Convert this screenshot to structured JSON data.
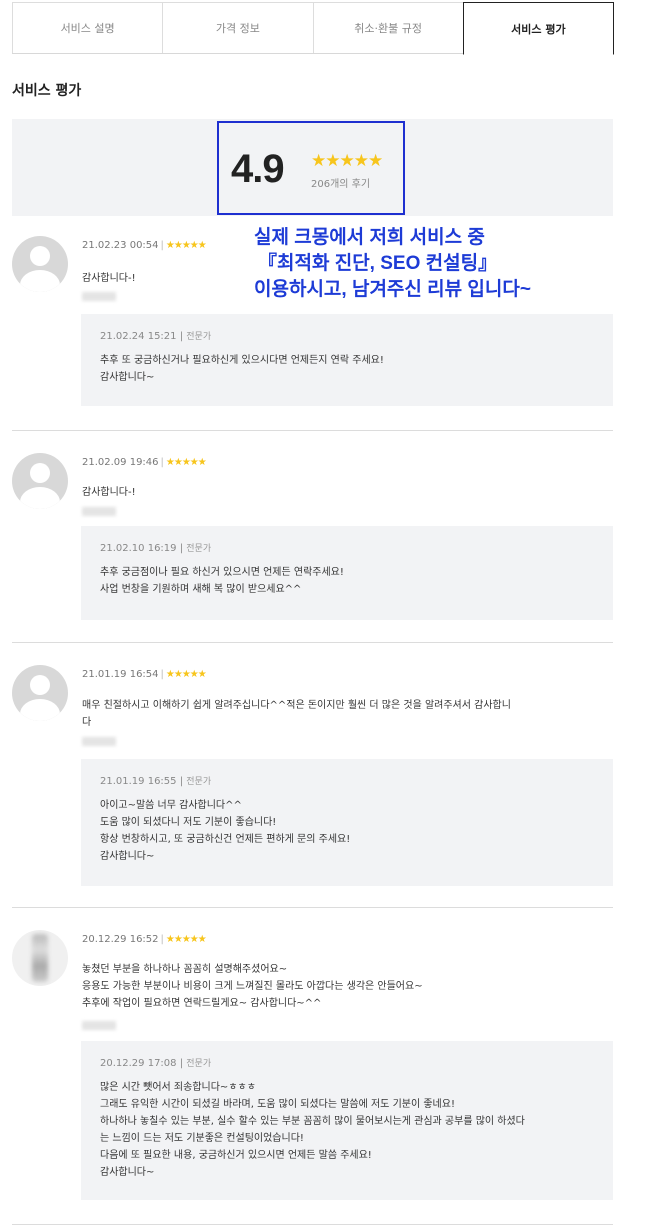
{
  "tabs": [
    {
      "label": "서비스 설명"
    },
    {
      "label": "가격 정보"
    },
    {
      "label": "취소·환불 규정"
    },
    {
      "label": "서비스 평가"
    }
  ],
  "section_title": "서비스 평가",
  "summary": {
    "score": "4.9",
    "stars": "★★★★★",
    "review_count": "206개의 후기",
    "highlight_color": "#1e2fd0"
  },
  "overlay": {
    "line1": "실제 크몽에서 저희 서비스 중",
    "line2": "『최적화 진단, SEO 컨설팅』",
    "line3": "이용하시고, 남겨주신 리뷰 입니다~",
    "color": "#1d3bd6"
  },
  "reviews": [
    {
      "date": "21.02.23 00:54",
      "stars": "★★★★★",
      "text": "감사합니다-!",
      "reply": {
        "date": "21.02.24 15:21",
        "role": "전문가",
        "text": "추후 또 궁금하신거나 필요하신게 있으시다면 언제든지 연락 주세요!\n감사합니다~"
      }
    },
    {
      "date": "21.02.09 19:46",
      "stars": "★★★★★",
      "text": "감사합니다-!",
      "reply": {
        "date": "21.02.10 16:19",
        "role": "전문가",
        "text": "추후 궁금점이나 필요 하신거 있으시면 언제든 연락주세요!\n사업 번창을 기원하며 새해 복 많이 받으세요^^"
      }
    },
    {
      "date": "21.01.19 16:54",
      "stars": "★★★★★",
      "text": "매우 친절하시고 이해하기 쉽게 알려주십니다^^적은 돈이지만 훨씬 더 많은 것을 알려주셔서 감사합니\n다",
      "reply": {
        "date": "21.01.19 16:55",
        "role": "전문가",
        "text": "아이고~말씀 너무 감사합니다^^\n도움 많이 되셨다니 저도 기분이 좋습니다!\n항상 번창하시고, 또 궁금하신건 언제든 편하게 문의 주세요!\n감사합니다~"
      }
    },
    {
      "date": "20.12.29 16:52",
      "stars": "★★★★★",
      "text": "놓쳤던 부분을 하나하나 꼼꼼히 설명해주셨어요~\n응용도 가능한 부분이나 비용이 크게 느껴질진 몰라도 아깝다는 생각은 안들어요~\n추후에 작업이 필요하면 연락드릴게요~ 감사합니다~^^",
      "reply": {
        "date": "20.12.29 17:08",
        "role": "전문가",
        "text": "많은 시간 뺏어서 죄송합니다~ㅎㅎㅎ\n그래도 유익한 시간이 되셨길 바라며, 도움 많이 되셨다는 말씀에 저도 기분이 좋네요!\n하나하나 놓칠수 있는 부분, 실수 할수 있는 부분 꼼꼼히 많이 물어보시는게 관심과 공부를 많이 하셨다\n는 느낌이 드는 저도 기분좋은 컨설팅이었습니다!\n다음에 또 필요한 내용, 궁금하신거 있으시면 언제든 말씀 주세요!\n감사합니다~"
      }
    }
  ]
}
